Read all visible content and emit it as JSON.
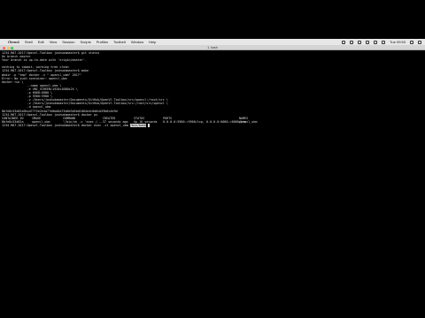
{
  "menubar": {
    "apple_glyph": "",
    "app_name": "iTerm2",
    "items": [
      "Shell",
      "Edit",
      "View",
      "Session",
      "Scripts",
      "Profiles",
      "Toolbelt",
      "Window",
      "Help"
    ],
    "status_time": "Tue 09:53"
  },
  "window": {
    "title": "1. bash",
    "traffic_colors": [
      "#fc605c",
      "#fdbc40",
      "#34c84a"
    ]
  },
  "terminal": {
    "lines_top": [
      "1234-MAT-2017:Openvl-Toolbox joshudamaster$ git status",
      "On branch master",
      "Your branch is up-to-date with 'origin/master'.",
      "",
      "nothing to commit, working tree clean",
      "1234-MAT-2017:Openvl-Toolbox joshudamaster$ make",
      "mkdir -p \"tmp\" docker -v \" openvl_ubm\" 2017\"",
      "Error: No such container: openvl_ubm",
      "docker run \\",
      "              --name openvl_ubm \\",
      "              -e VNC_SCREEN=1920x1080x24 \\",
      "              -p 6080:6080 \\",
      "              -p 5900:5900 \\",
      "              -v /Users/joshudamaster/Documents/GitHub/OpenVl-Toolbox/src/openvl:/root/src \\",
      "              -v /Users/joshudamaster/Documents/GitHub/OpenVl-Toolbox/src:/root/src/openvl \\",
      "              -d openvl_ubm",
      "8bfe8c53d02a9bcd77f5e2e4a77e0bd0a73d0d3d5bd1004e4c0d0cb59b8c4e9d",
      "1234-MAT-2017:Openvl-Toolbox joshudamaster$ docker ps"
    ],
    "ps_headers": [
      "CONTAINER ID",
      "IMAGE",
      "COMMAND",
      "CREATED",
      "STATUS",
      "PORTS",
      "NAMES"
    ],
    "ps_row": [
      "8bfe8c53d02a",
      "openvl_ubm",
      "\"/bin/sh -c 'exec /...\"",
      "17 seconds ago",
      "Up 16 seconds",
      "0.0.0.0:5900->5900/tcp, 0.0.0.0:6080->6080/tcp",
      "openvl_ubm"
    ],
    "last_prompt": "1234-MAT-2017:Openvl-Toolbox joshudamaster$ docker exec -it openvl_ubm",
    "last_selected": "/bin/bash"
  }
}
